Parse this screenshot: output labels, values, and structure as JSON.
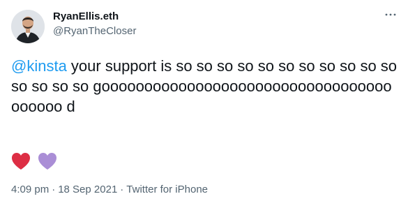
{
  "author": {
    "display_name": "RyanEllis.eth",
    "handle": "@RyanTheCloser",
    "avatar_icon": "profile-photo"
  },
  "more_icon": "more-horizontal-icon",
  "tweet": {
    "mention": "@kinsta",
    "text": " your support is so so so so so so so so so so so so so so so goooooooooooooooooooooooooooooooooooooooo d",
    "emojis": [
      {
        "name": "red-heart-icon",
        "color": "#dd2e44"
      },
      {
        "name": "purple-heart-icon",
        "color": "#aa8ed6"
      }
    ]
  },
  "meta": {
    "time": "4:09 pm",
    "date": "18 Sep 2021",
    "source": "Twitter for iPhone",
    "separator": "·"
  },
  "colors": {
    "text": "#0f1419",
    "secondary": "#536471",
    "accent": "#1d9bf0"
  }
}
